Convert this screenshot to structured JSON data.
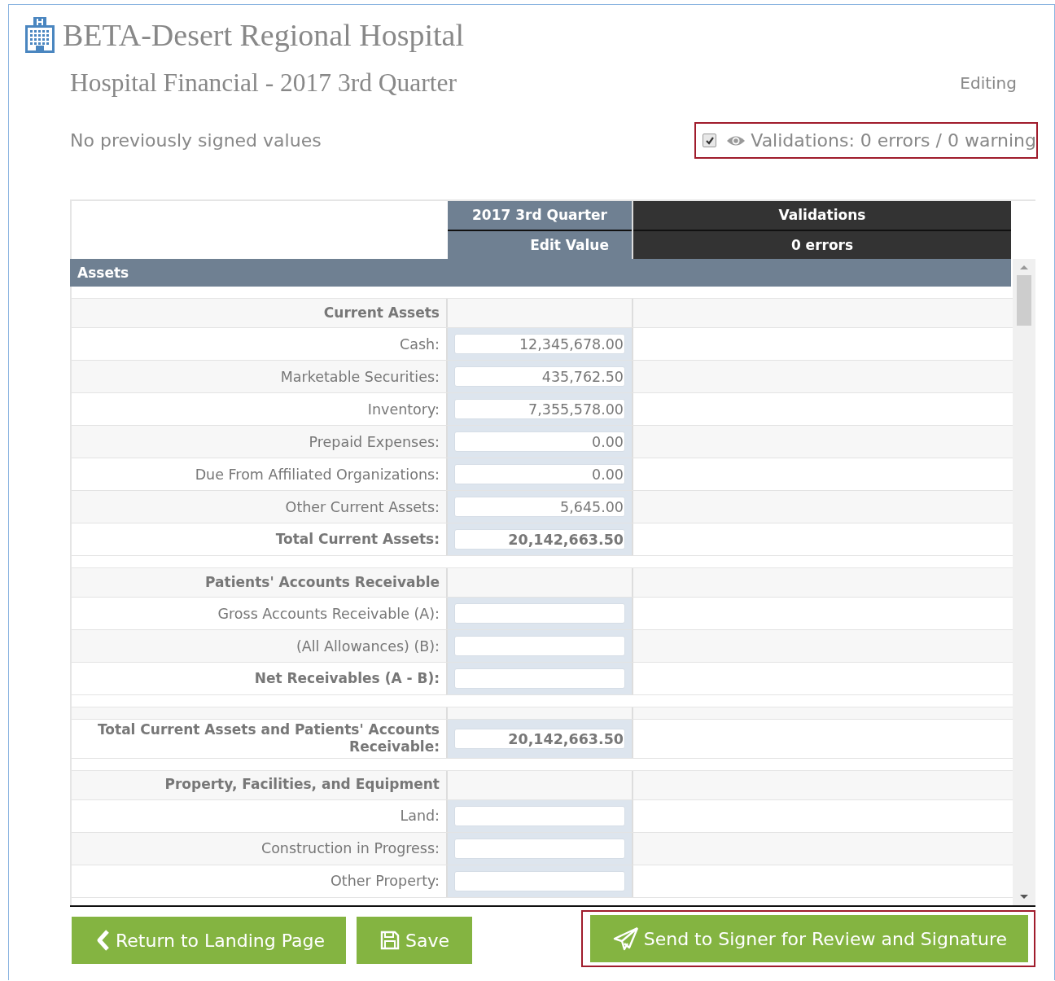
{
  "header": {
    "title": "BETA-Desert Regional Hospital"
  },
  "report": {
    "title": "Hospital Financial - 2017 3rd Quarter",
    "mode": "Editing",
    "signed_note": "No previously signed values"
  },
  "validation_toggle": {
    "checked": true,
    "label": "Validations: 0 errors / 0 warning",
    "highlighted": true
  },
  "table": {
    "columns": [
      {
        "title": "2017 3rd Quarter",
        "subtitle": "Edit Value",
        "kind": "period"
      },
      {
        "title": "Validations",
        "subtitle": "0 errors",
        "kind": "validation"
      }
    ],
    "sections": [
      {
        "title": "Assets",
        "groups": [
          {
            "heading": "Current Assets",
            "rows": [
              {
                "label": "Cash:",
                "value": "12,345,678.00",
                "bold": false
              },
              {
                "label": "Marketable Securities:",
                "value": "435,762.50",
                "bold": false
              },
              {
                "label": "Inventory:",
                "value": "7,355,578.00",
                "bold": false
              },
              {
                "label": "Prepaid Expenses:",
                "value": "0.00",
                "bold": false
              },
              {
                "label": "Due From Affiliated Organizations:",
                "value": "0.00",
                "bold": false
              },
              {
                "label": "Other Current Assets:",
                "value": "5,645.00",
                "bold": false
              },
              {
                "label": "Total Current Assets:",
                "value": "20,142,663.50",
                "bold": true
              }
            ]
          },
          {
            "heading": "Patients' Accounts Receivable",
            "rows": [
              {
                "label": "Gross Accounts Receivable (A):",
                "bold": false
              },
              {
                "label": "(All Allowances) (B):",
                "bold": false
              },
              {
                "label": "Net Receivables (A - B):",
                "bold": true
              }
            ]
          },
          {
            "rows": [
              {
                "label": "Total Current Assets and Patients' Accounts Receivable:",
                "value": "20,142,663.50",
                "bold": true
              }
            ]
          },
          {
            "heading": "Property, Facilities, and Equipment",
            "rows": [
              {
                "label": "Land:",
                "bold": false
              },
              {
                "label": "Construction in Progress:",
                "bold": false
              },
              {
                "label": "Other Property:",
                "bold": false
              }
            ]
          }
        ]
      }
    ]
  },
  "buttons": [
    {
      "label": "Return to Landing Page",
      "kind": "back",
      "highlighted": false
    },
    {
      "label": "Save",
      "kind": "save",
      "highlighted": false
    },
    {
      "label": "Send to Signer for Review and Signature",
      "kind": "send",
      "highlighted": true
    }
  ]
}
